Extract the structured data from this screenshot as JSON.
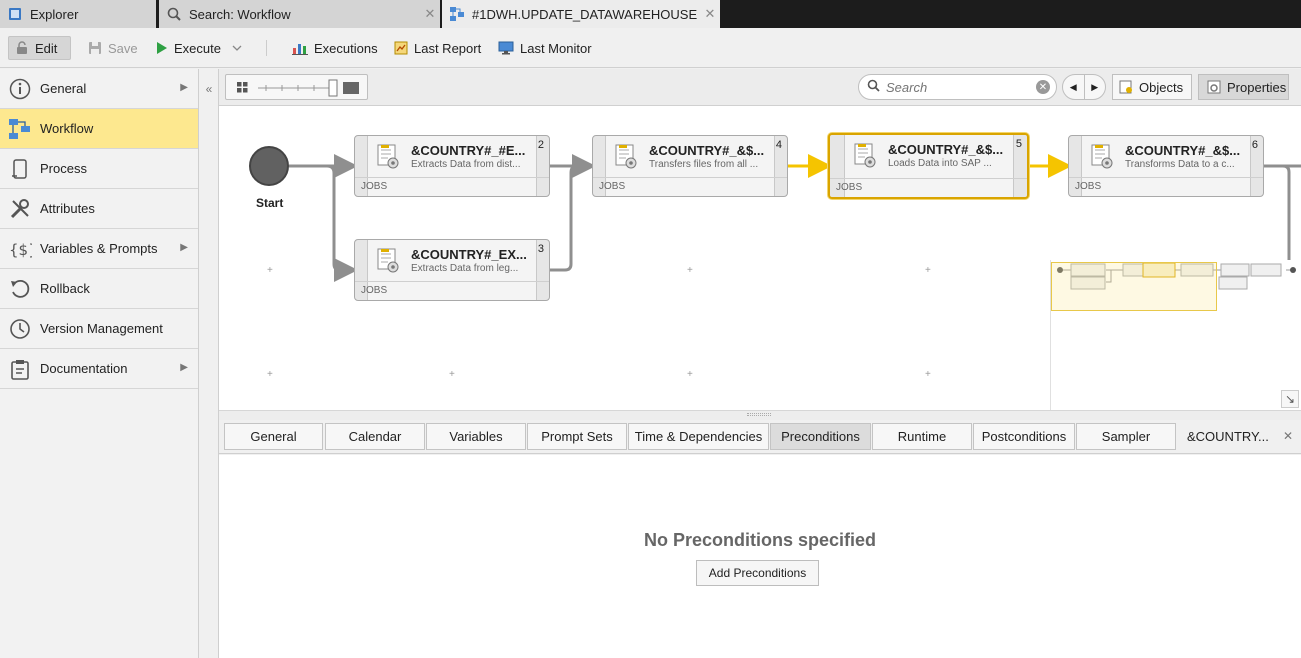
{
  "tabs": [
    {
      "label": "Explorer",
      "icon": "explorer-icon"
    },
    {
      "label": "Search: Workflow",
      "icon": "search-icon"
    },
    {
      "label": "#1DWH.UPDATE_DATAWAREHOUSE",
      "icon": "workflow-icon"
    }
  ],
  "toolbar": {
    "edit": "Edit",
    "save": "Save",
    "execute": "Execute",
    "executions": "Executions",
    "last_report": "Last Report",
    "last_monitor": "Last Monitor"
  },
  "sidebar": {
    "items": [
      {
        "label": "General",
        "icon": "info-icon",
        "has_submenu": true
      },
      {
        "label": "Workflow",
        "icon": "workflow-icon",
        "active": true
      },
      {
        "label": "Process",
        "icon": "process-icon"
      },
      {
        "label": "Attributes",
        "icon": "tools-icon"
      },
      {
        "label": "Variables & Prompts",
        "icon": "variables-icon",
        "has_submenu": true
      },
      {
        "label": "Rollback",
        "icon": "rollback-icon"
      },
      {
        "label": "Version Management",
        "icon": "clock-icon"
      },
      {
        "label": "Documentation",
        "icon": "clipboard-icon",
        "has_submenu": true
      }
    ]
  },
  "canvas_toolbar": {
    "search_placeholder": "Search",
    "objects": "Objects",
    "properties": "Properties"
  },
  "workflow": {
    "start_label": "Start",
    "nodes": [
      {
        "num": "2",
        "title": "&COUNTRY#_#E...",
        "desc": "Extracts Data from dist...",
        "type": "JOBS"
      },
      {
        "num": "3",
        "title": "&COUNTRY#_EX...",
        "desc": "Extracts Data from leg...",
        "type": "JOBS"
      },
      {
        "num": "4",
        "title": "&COUNTRY#_&$...",
        "desc": "Transfers files from all ...",
        "type": "JOBS"
      },
      {
        "num": "5",
        "title": "&COUNTRY#_&$...",
        "desc": "Loads Data into SAP ...",
        "type": "JOBS",
        "selected": true
      },
      {
        "num": "6",
        "title": "&COUNTRY#_&$...",
        "desc": "Transforms Data to a c...",
        "type": "JOBS"
      }
    ]
  },
  "bottom_tabs": [
    {
      "label": "General"
    },
    {
      "label": "Calendar"
    },
    {
      "label": "Variables"
    },
    {
      "label": "Prompt Sets"
    },
    {
      "label": "Time & Dependencies"
    },
    {
      "label": "Preconditions",
      "active": true
    },
    {
      "label": "Runtime"
    },
    {
      "label": "Postconditions"
    },
    {
      "label": "Sampler"
    },
    {
      "label": "&COUNTRY..."
    }
  ],
  "preconditions": {
    "empty_message": "No Preconditions specified",
    "add_button": "Add Preconditions"
  },
  "colors": {
    "active_highlight": "#fde88f",
    "selected_border": "#d9a400",
    "active_connector": "#f5c400",
    "connector": "#8f8f8f",
    "execute_green": "#2ea043"
  }
}
